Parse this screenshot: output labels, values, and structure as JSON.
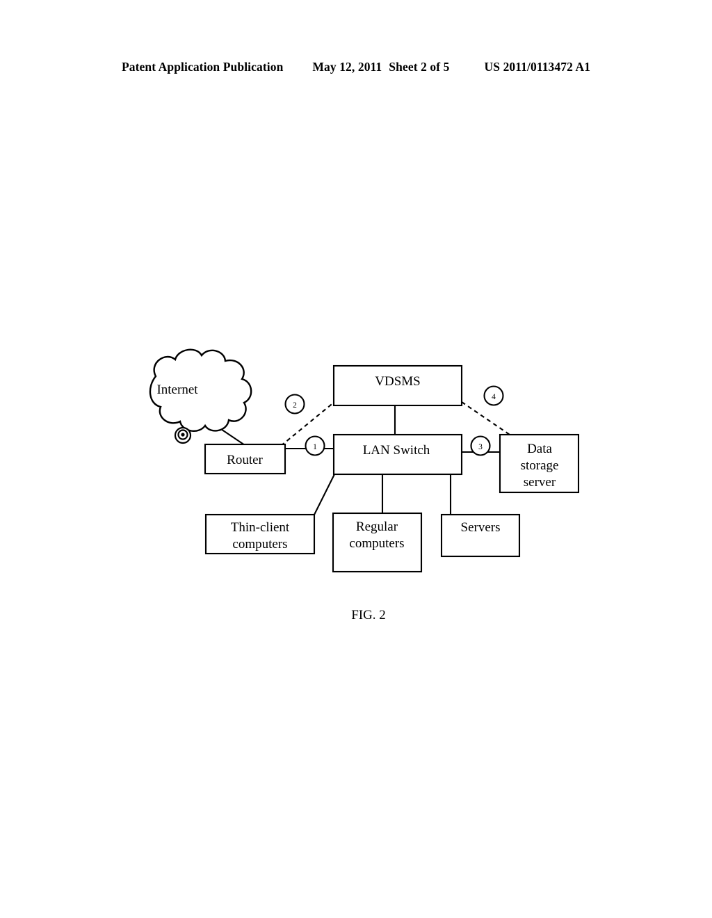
{
  "header": {
    "publication": "Patent Application Publication",
    "date": "May 12, 2011",
    "sheet": "Sheet 2 of 5",
    "patent_number": "US 2011/0113472 A1"
  },
  "figure": {
    "caption": "FIG. 2",
    "nodes": {
      "internet": {
        "label": "Internet"
      },
      "router": {
        "label": "Router"
      },
      "vdsms": {
        "label": "VDSMS"
      },
      "lan_switch": {
        "label": "LAN Switch"
      },
      "data_storage_server": {
        "line1": "Data",
        "line2": "storage",
        "line3": "server"
      },
      "thin_client": {
        "line1": "Thin-client",
        "line2": "computers"
      },
      "regular_computers": {
        "line1": "Regular",
        "line2": "computers"
      },
      "servers": {
        "label": "Servers"
      }
    },
    "reference_numerals": {
      "one": "1",
      "two": "2",
      "three": "3",
      "four": "4"
    },
    "colors": {
      "stroke": "#000000",
      "fill": "#ffffff"
    }
  }
}
